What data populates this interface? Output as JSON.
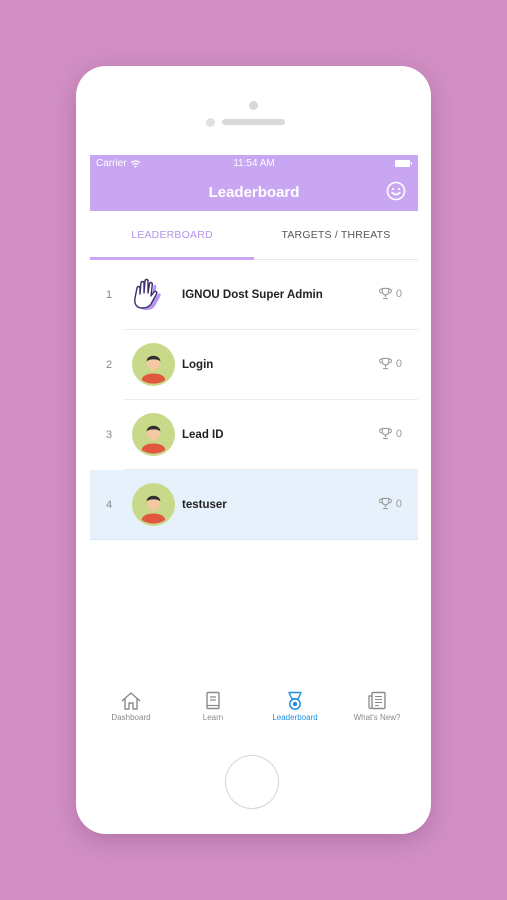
{
  "status_bar": {
    "carrier": "Carrier",
    "time": "11:54 AM"
  },
  "app_bar": {
    "title": "Leaderboard",
    "action_icon": "smiley-icon"
  },
  "tabs": [
    {
      "label": "LEADERBOARD",
      "active": true
    },
    {
      "label": "TARGETS / THREATS",
      "active": false
    }
  ],
  "leaderboard": [
    {
      "rank": "1",
      "name": "IGNOU Dost Super Admin",
      "score": "0",
      "avatar": "hand-icon"
    },
    {
      "rank": "2",
      "name": "Login",
      "score": "0",
      "avatar": "user-avatar"
    },
    {
      "rank": "3",
      "name": "Lead ID",
      "score": "0",
      "avatar": "user-avatar"
    },
    {
      "rank": "4",
      "name": "testuser",
      "score": "0",
      "avatar": "user-avatar",
      "highlighted": true
    }
  ],
  "bottom_nav": [
    {
      "label": "Dashboard",
      "icon": "home-icon"
    },
    {
      "label": "Learn",
      "icon": "book-icon"
    },
    {
      "label": "Leaderboard",
      "icon": "medal-icon",
      "active": true
    },
    {
      "label": "What's New?",
      "icon": "news-icon"
    }
  ],
  "colors": {
    "background": "#d18fc4",
    "accent": "#c8a6f1",
    "active_tab_text": "#b493e8",
    "nav_active": "#1f8fe0",
    "highlight_row": "#e6f1fb"
  }
}
